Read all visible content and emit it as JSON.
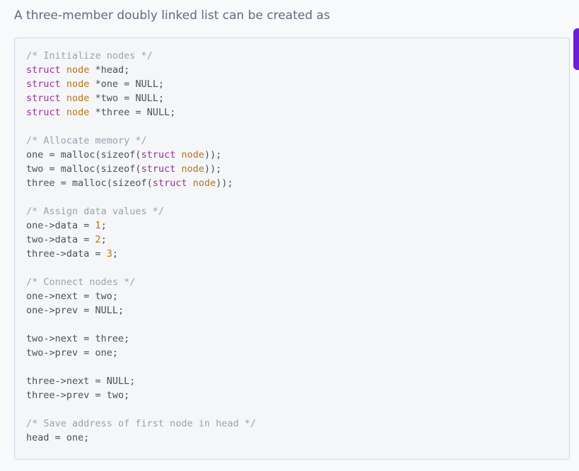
{
  "intro_text": "A three-member doubly linked list can be created as",
  "colors": {
    "comment": "#9aa2ad",
    "keyword": "#9a2f9c",
    "type": "#b5761b",
    "number": "#b5761b",
    "plain": "#4c4f57",
    "accent": "#6a1fd6"
  },
  "code_lines": [
    [
      {
        "t": "/* Initialize nodes */",
        "k": "comment"
      }
    ],
    [
      {
        "t": "struct",
        "k": "keyword"
      },
      {
        "t": " ",
        "k": "plain"
      },
      {
        "t": "node",
        "k": "type"
      },
      {
        "t": " *head;",
        "k": "plain"
      }
    ],
    [
      {
        "t": "struct",
        "k": "keyword"
      },
      {
        "t": " ",
        "k": "plain"
      },
      {
        "t": "node",
        "k": "type"
      },
      {
        "t": " *one = NULL;",
        "k": "plain"
      }
    ],
    [
      {
        "t": "struct",
        "k": "keyword"
      },
      {
        "t": " ",
        "k": "plain"
      },
      {
        "t": "node",
        "k": "type"
      },
      {
        "t": " *two = NULL;",
        "k": "plain"
      }
    ],
    [
      {
        "t": "struct",
        "k": "keyword"
      },
      {
        "t": " ",
        "k": "plain"
      },
      {
        "t": "node",
        "k": "type"
      },
      {
        "t": " *three = NULL;",
        "k": "plain"
      }
    ],
    [],
    [
      {
        "t": "/* Allocate memory */",
        "k": "comment"
      }
    ],
    [
      {
        "t": "one = malloc(sizeof(",
        "k": "plain"
      },
      {
        "t": "struct",
        "k": "keyword"
      },
      {
        "t": " ",
        "k": "plain"
      },
      {
        "t": "node",
        "k": "type"
      },
      {
        "t": "));",
        "k": "plain"
      }
    ],
    [
      {
        "t": "two = malloc(sizeof(",
        "k": "plain"
      },
      {
        "t": "struct",
        "k": "keyword"
      },
      {
        "t": " ",
        "k": "plain"
      },
      {
        "t": "node",
        "k": "type"
      },
      {
        "t": "));",
        "k": "plain"
      }
    ],
    [
      {
        "t": "three = malloc(sizeof(",
        "k": "plain"
      },
      {
        "t": "struct",
        "k": "keyword"
      },
      {
        "t": " ",
        "k": "plain"
      },
      {
        "t": "node",
        "k": "type"
      },
      {
        "t": "));",
        "k": "plain"
      }
    ],
    [],
    [
      {
        "t": "/* Assign data values */",
        "k": "comment"
      }
    ],
    [
      {
        "t": "one->data = ",
        "k": "plain"
      },
      {
        "t": "1",
        "k": "number"
      },
      {
        "t": ";",
        "k": "plain"
      }
    ],
    [
      {
        "t": "two->data = ",
        "k": "plain"
      },
      {
        "t": "2",
        "k": "number"
      },
      {
        "t": ";",
        "k": "plain"
      }
    ],
    [
      {
        "t": "three->data = ",
        "k": "plain"
      },
      {
        "t": "3",
        "k": "number"
      },
      {
        "t": ";",
        "k": "plain"
      }
    ],
    [],
    [
      {
        "t": "/* Connect nodes */",
        "k": "comment"
      }
    ],
    [
      {
        "t": "one->next = two;",
        "k": "plain"
      }
    ],
    [
      {
        "t": "one->prev = NULL;",
        "k": "plain"
      }
    ],
    [],
    [
      {
        "t": "two->next = three;",
        "k": "plain"
      }
    ],
    [
      {
        "t": "two->prev = one;",
        "k": "plain"
      }
    ],
    [],
    [
      {
        "t": "three->next = NULL;",
        "k": "plain"
      }
    ],
    [
      {
        "t": "three->prev = two;",
        "k": "plain"
      }
    ],
    [],
    [
      {
        "t": "/* Save address of first node in head */",
        "k": "comment"
      }
    ],
    [
      {
        "t": "head = one;",
        "k": "plain"
      }
    ]
  ]
}
